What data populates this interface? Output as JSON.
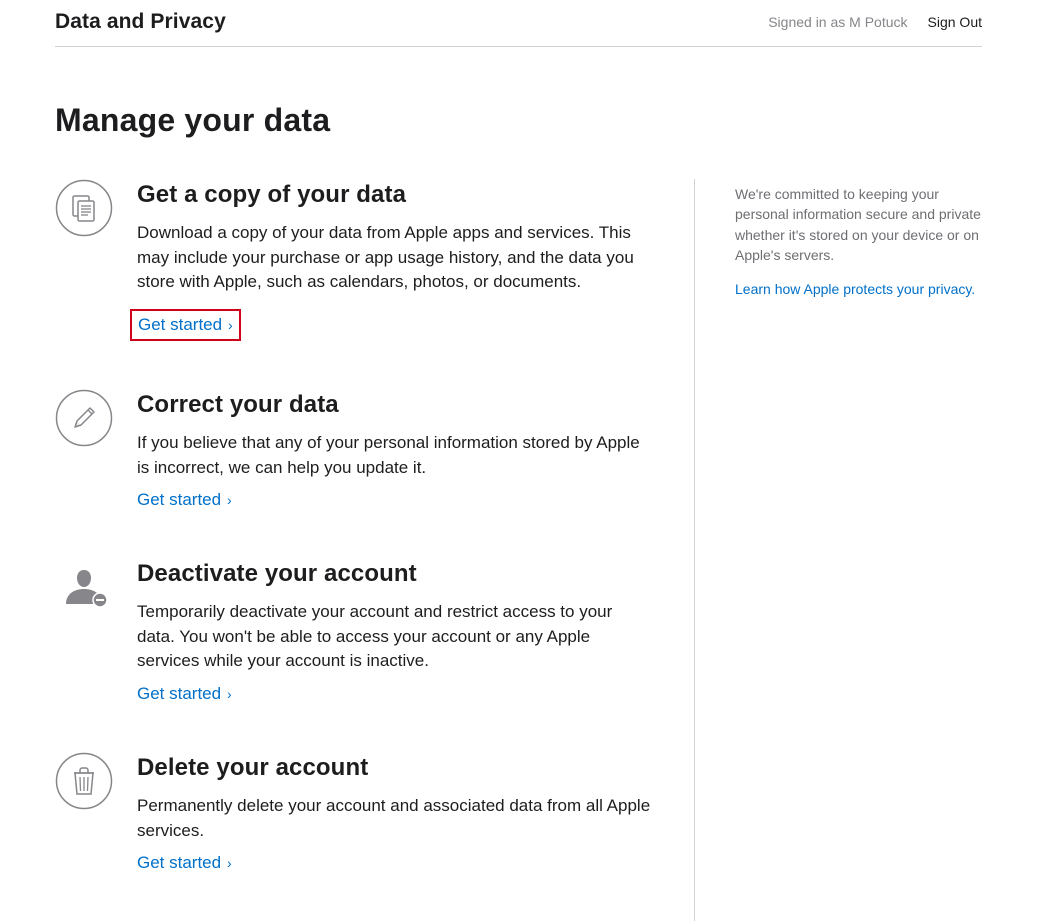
{
  "header": {
    "title": "Data and Privacy",
    "signed_in": "Signed in as M Potuck",
    "sign_out": "Sign Out"
  },
  "page": {
    "heading": "Manage your data"
  },
  "sections": [
    {
      "title": "Get a copy of your data",
      "desc": "Download a copy of your data from Apple apps and services. This may include your purchase or app usage history, and the data you store with Apple, such as calendars, photos, or documents.",
      "link": "Get started"
    },
    {
      "title": "Correct your data",
      "desc": "If you believe that any of your personal information stored by Apple is incorrect, we can help you update it.",
      "link": "Get started"
    },
    {
      "title": "Deactivate your account",
      "desc": "Temporarily deactivate your account and restrict access to your data. You won't be able to access your account or any Apple services while your account is inactive.",
      "link": "Get started"
    },
    {
      "title": "Delete your account",
      "desc": "Permanently delete your account and associated data from all Apple services.",
      "link": "Get started"
    }
  ],
  "sidebar": {
    "text": "We're committed to keeping your personal information secure and private whether it's stored on your device or on Apple's servers.",
    "link": "Learn how Apple protects your privacy."
  }
}
